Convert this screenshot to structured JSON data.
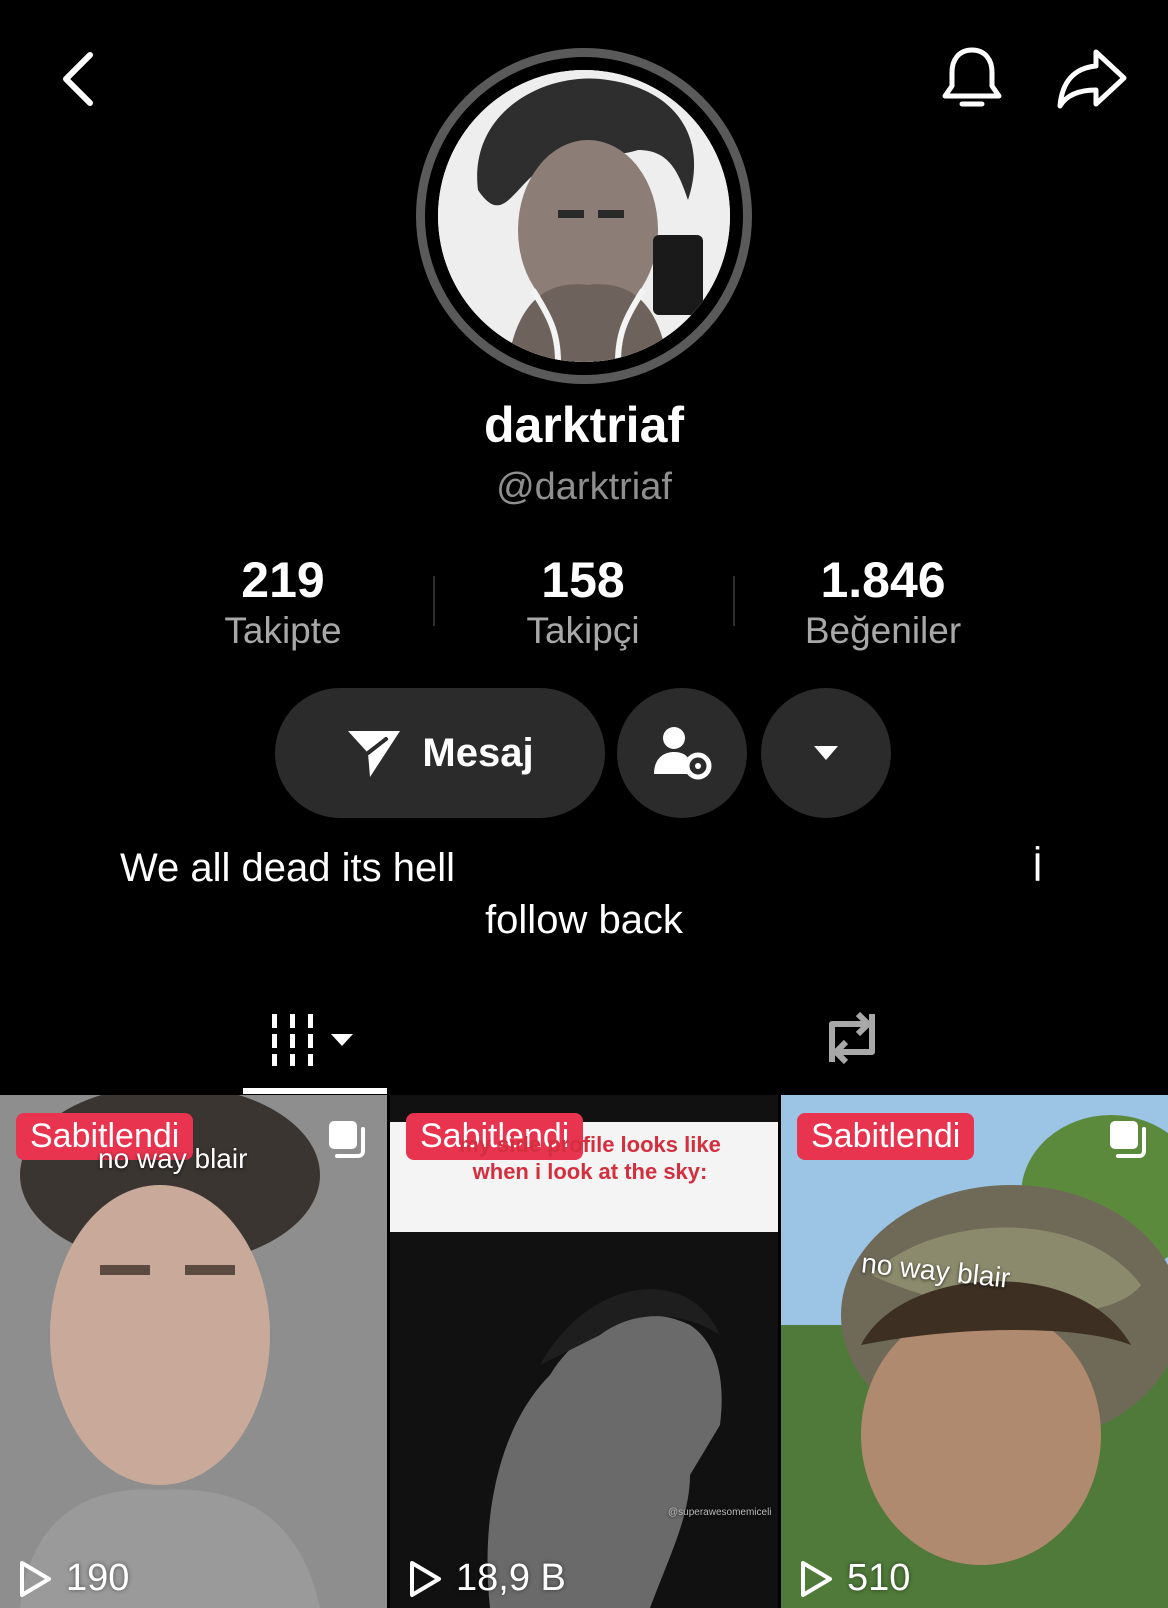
{
  "profile": {
    "display_name": "darktriaf",
    "handle": "@darktriaf"
  },
  "stats": [
    {
      "value": "219",
      "label": "Takipte"
    },
    {
      "value": "158",
      "label": "Takipçi"
    },
    {
      "value": "1.846",
      "label": "Beğeniler"
    }
  ],
  "actions": {
    "message_label": "Mesaj",
    "icons": {
      "message": "paper-plane-icon",
      "manage": "person-gear-icon",
      "more": "caret-down-icon"
    }
  },
  "bio": {
    "line1": "We all dead its hell",
    "mark": "İ",
    "line2": "follow back"
  },
  "tabs": [
    {
      "icon": "videos-grid-icon",
      "active": true
    },
    {
      "icon": "repost-icon",
      "active": false
    }
  ],
  "videos": [
    {
      "badge": "Sabitlendi",
      "caption": "no way blair",
      "views": "190"
    },
    {
      "badge": "Sabitlendi",
      "caption": "my side profile looks like when i look at the sky:",
      "views": "18,9 B",
      "credit": "@superawesomemiceli"
    },
    {
      "badge": "Sabitlendi",
      "caption": "no way blair",
      "views": "510"
    }
  ],
  "colors": {
    "badge": "#e8344f",
    "button_bg": "#2b2b2b",
    "secondary_text": "#a8a8a8"
  }
}
